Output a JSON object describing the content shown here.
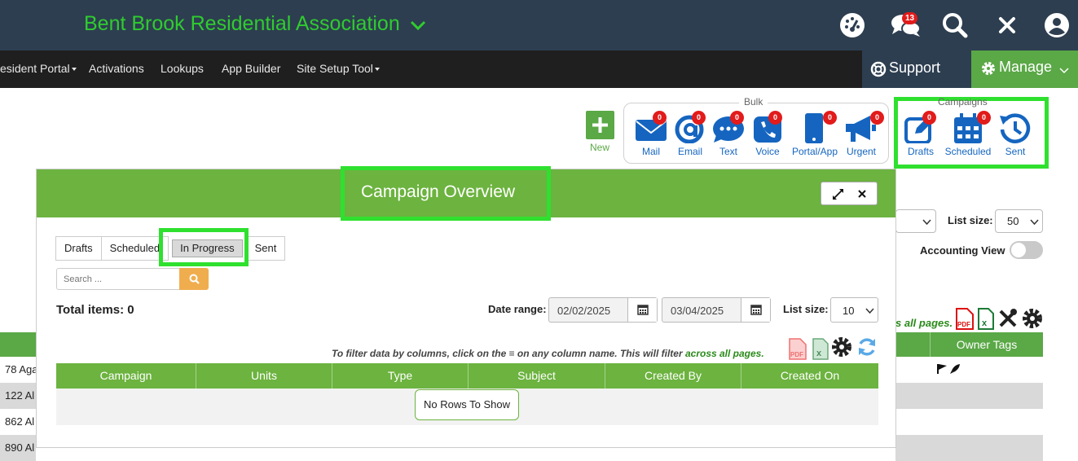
{
  "header": {
    "org_name": "Bent Brook Residential Association",
    "notifications_count": "13",
    "icons": [
      "dashboard-gauge-icon",
      "chat-bubbles-icon",
      "search-icon",
      "close-icon",
      "user-avatar-icon"
    ]
  },
  "nav": {
    "items": [
      {
        "label": "esident Portal",
        "dropdown": true
      },
      {
        "label": "Activations",
        "dropdown": false
      },
      {
        "label": "Lookups",
        "dropdown": false
      },
      {
        "label": "App Builder",
        "dropdown": false
      },
      {
        "label": "Site Setup Tool",
        "dropdown": true
      }
    ],
    "support_label": "Support",
    "manage_label": "Manage"
  },
  "toolbar": {
    "new_label": "New",
    "bulk_legend": "Bulk",
    "campaigns_legend": "Campaigns",
    "bulk": [
      {
        "label": "Mail",
        "badge": "0",
        "icon": "envelope-icon"
      },
      {
        "label": "Email",
        "badge": "0",
        "icon": "at-sign-icon"
      },
      {
        "label": "Text",
        "badge": "0",
        "icon": "chat-dots-icon"
      },
      {
        "label": "Voice",
        "badge": "0",
        "icon": "phone-icon"
      },
      {
        "label": "Portal/App",
        "badge": "0",
        "icon": "mobile-icon"
      },
      {
        "label": "Urgent",
        "badge": "0",
        "icon": "megaphone-icon"
      }
    ],
    "campaigns": [
      {
        "label": "Drafts",
        "badge": "0",
        "icon": "edit-icon"
      },
      {
        "label": "Scheduled",
        "badge": "0",
        "icon": "calendar-icon"
      },
      {
        "label": "Sent",
        "badge": "",
        "icon": "history-icon"
      }
    ],
    "accent": "#1565c0"
  },
  "background_page": {
    "list_size_label": "List size:",
    "list_size_value": "50",
    "accounting_view_label": "Accounting View",
    "filter_note_tail": "s all pages.",
    "owner_tags_header": "Owner Tags",
    "rows": [
      "78 Aga",
      "122 Al",
      "862 Al",
      "890 Al"
    ]
  },
  "modal": {
    "title": "Campaign Overview",
    "tabs": [
      {
        "label": "Drafts",
        "active": false
      },
      {
        "label": "Scheduled",
        "active": false
      },
      {
        "label": "In Progress",
        "active": true
      },
      {
        "label": "Sent",
        "active": false
      }
    ],
    "search_placeholder": "Search ...",
    "total_items": "Total items: 0",
    "date_range_label": "Date range:",
    "date_from": "02/02/2025",
    "date_to": "03/04/2025",
    "list_size_label": "List size:",
    "list_size_value": "10",
    "filter_note": "To filter data by columns, click on the ≡ on any column name. This will filter ",
    "filter_note_green": "across all pages.",
    "columns": [
      "Campaign",
      "Units",
      "Type",
      "Subject",
      "Created By",
      "Created On"
    ],
    "no_rows": "No Rows To Show",
    "header_color": "#6cb33f",
    "highlight_color": "#2fe02f"
  }
}
